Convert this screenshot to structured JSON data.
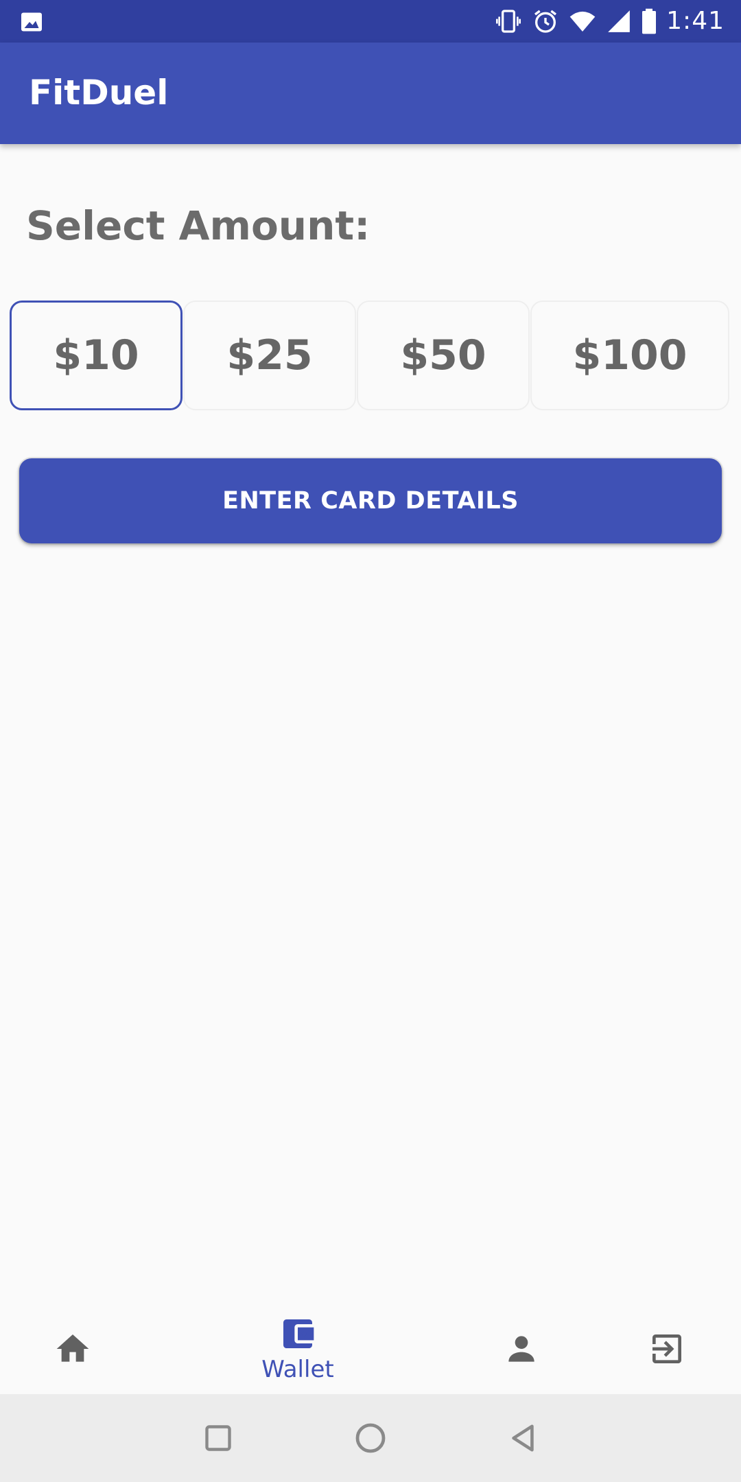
{
  "status_bar": {
    "time": "1:41",
    "icons": [
      "image-icon",
      "vibrate-icon",
      "alarm-icon",
      "wifi-icon",
      "signal-icon",
      "battery-icon"
    ]
  },
  "app_bar": {
    "title": "FitDuel"
  },
  "content": {
    "select_label": "Select Amount:",
    "amounts": [
      {
        "label": "$10",
        "selected": true
      },
      {
        "label": "$25",
        "selected": false
      },
      {
        "label": "$50",
        "selected": false
      },
      {
        "label": "$100",
        "selected": false
      }
    ],
    "cta_label": "ENTER CARD DETAILS"
  },
  "bottom_nav": {
    "items": [
      {
        "icon": "home-icon",
        "label": ""
      },
      {
        "icon": "wallet-icon",
        "label": "Wallet",
        "active": true
      },
      {
        "icon": "person-icon",
        "label": ""
      },
      {
        "icon": "exit-icon",
        "label": ""
      }
    ]
  },
  "colors": {
    "primary": "#3f51b5",
    "primary_dark": "#303f9f",
    "text_gray": "#666666"
  }
}
